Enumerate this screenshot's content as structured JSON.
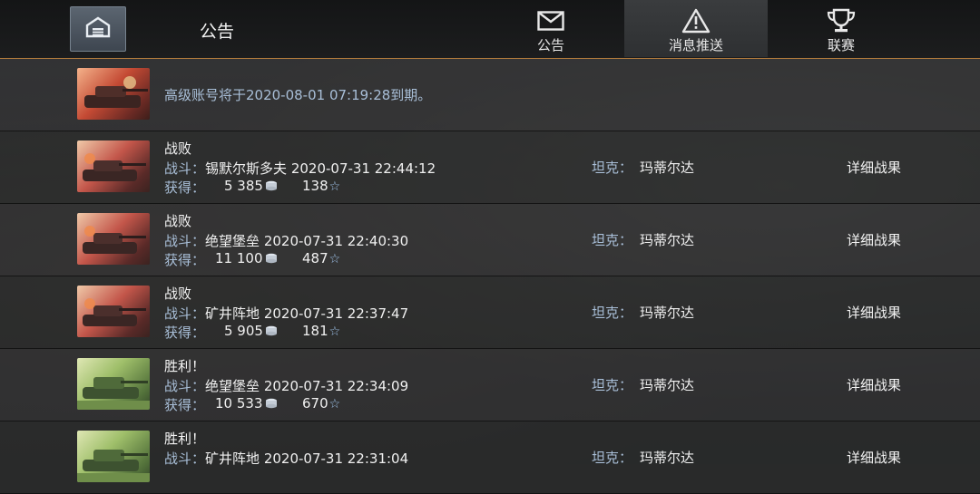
{
  "header": {
    "page_title": "公告",
    "tabs": [
      {
        "label": "公告",
        "icon": "envelope-icon"
      },
      {
        "label": "消息推送",
        "icon": "warning-icon"
      },
      {
        "label": "联赛",
        "icon": "trophy-icon"
      }
    ],
    "active_tab": "消息推送"
  },
  "notice": {
    "text": "高级账号将于2020-08-01 07:19:28到期。"
  },
  "labels": {
    "battle": "战斗：",
    "earned": "获得：",
    "tank": "坦克：",
    "details": "详细战果"
  },
  "battles": [
    {
      "result": "战败",
      "map": "锡默尔斯多夫",
      "time": "2020-07-31 22:44:12",
      "silver": "5 385",
      "xp": "138",
      "tank": "玛蒂尔达"
    },
    {
      "result": "战败",
      "map": "绝望堡垒",
      "time": "2020-07-31 22:40:30",
      "silver": "11 100",
      "xp": "487",
      "tank": "玛蒂尔达"
    },
    {
      "result": "战败",
      "map": "矿井阵地",
      "time": "2020-07-31 22:37:47",
      "silver": "5 905",
      "xp": "181",
      "tank": "玛蒂尔达"
    },
    {
      "result": "胜利！",
      "map": "绝望堡垒",
      "time": "2020-07-31 22:34:09",
      "silver": "10 533",
      "xp": "670",
      "tank": "玛蒂尔达"
    },
    {
      "result": "胜利！",
      "map": "矿井阵地",
      "time": "2020-07-31 22:31:04",
      "silver": "",
      "xp": "",
      "tank": "玛蒂尔达"
    }
  ],
  "colors": {
    "accent_border": "#b07a3c",
    "label_blue": "#a9bfd8",
    "xp_star": "#9fc3ea"
  }
}
